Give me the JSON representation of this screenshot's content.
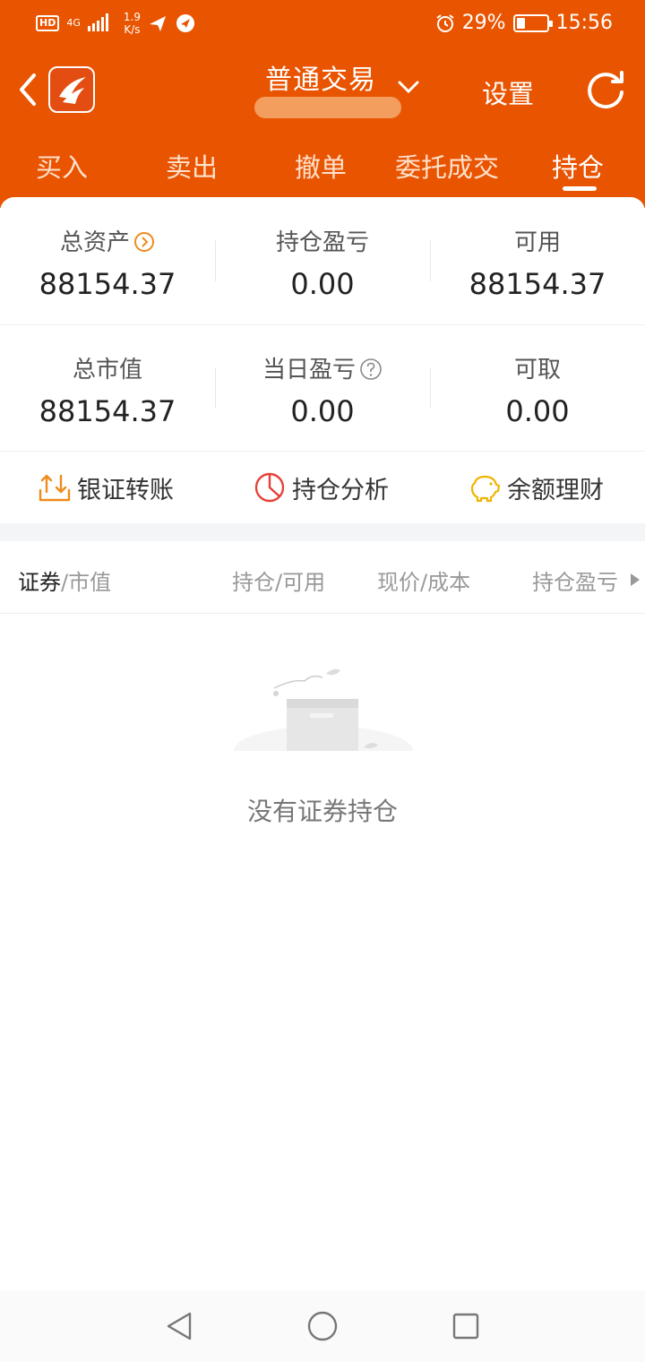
{
  "status_bar": {
    "network_chip": "HD",
    "network_gen": "4G",
    "speed_value": "1.9",
    "speed_unit": "K/s",
    "battery_percent": 29,
    "battery_text": "29%",
    "time": "15:56"
  },
  "header": {
    "title": "普通交易",
    "settings_label": "设置"
  },
  "tabs": [
    {
      "label": "买入"
    },
    {
      "label": "卖出"
    },
    {
      "label": "撤单"
    },
    {
      "label": "委托成交"
    },
    {
      "label": "持仓",
      "active": true
    }
  ],
  "summary": {
    "row1": [
      {
        "label": "总资产",
        "value": "88154.37"
      },
      {
        "label": "持仓盈亏",
        "value": "0.00"
      },
      {
        "label": "可用",
        "value": "88154.37"
      }
    ],
    "row2": [
      {
        "label": "总市值",
        "value": "88154.37"
      },
      {
        "label": "当日盈亏",
        "value": "0.00"
      },
      {
        "label": "可取",
        "value": "0.00"
      }
    ]
  },
  "actions": [
    {
      "label": "银证转账",
      "icon": "transfer-icon"
    },
    {
      "label": "持仓分析",
      "icon": "pie-chart-icon"
    },
    {
      "label": "余额理财",
      "icon": "piggy-bank-icon"
    }
  ],
  "holdings_header": {
    "col1_strong": "证券",
    "col1_rest": "/市值",
    "col2": "持仓/可用",
    "col3": "现价/成本",
    "col4": "持仓盈亏"
  },
  "empty_state": {
    "message": "没有证券持仓"
  },
  "colors": {
    "brand": "#e95400",
    "accent_orange": "#f08a1c",
    "accent_red": "#e5413a",
    "accent_yellow": "#f0b400"
  }
}
